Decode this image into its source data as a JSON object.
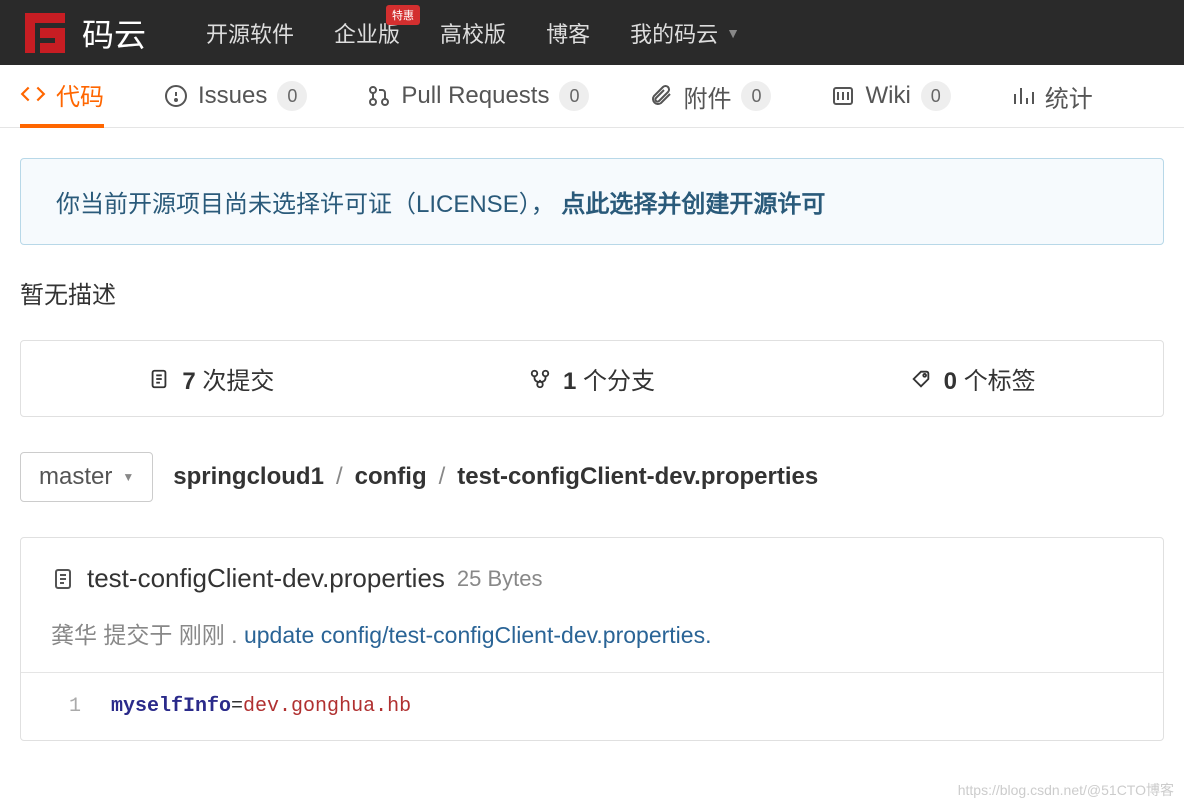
{
  "topNav": {
    "logoText": "码云",
    "items": [
      "开源软件",
      "企业版",
      "高校版",
      "博客"
    ],
    "badge": "特惠",
    "myNav": "我的码云"
  },
  "subNav": {
    "code": "代码",
    "issues": {
      "label": "Issues",
      "count": "0"
    },
    "pr": {
      "label": "Pull Requests",
      "count": "0"
    },
    "attach": {
      "label": "附件",
      "count": "0"
    },
    "wiki": {
      "label": "Wiki",
      "count": "0"
    },
    "stats": "统计"
  },
  "notice": {
    "text": "你当前开源项目尚未选择许可证（LICENSE），",
    "link": "点此选择并创建开源许可"
  },
  "noDesc": "暂无描述",
  "stats": {
    "commits": {
      "count": "7",
      "label": "次提交"
    },
    "branches": {
      "count": "1",
      "label": "个分支"
    },
    "tags": {
      "count": "0",
      "label": "个标签"
    }
  },
  "branch": "master",
  "breadcrumb": [
    "springcloud1",
    "config",
    "test-configClient-dev.properties"
  ],
  "file": {
    "name": "test-configClient-dev.properties",
    "size": "25 Bytes",
    "author": "龚华",
    "submitLabel": "提交于",
    "time": "刚刚",
    "commitMsg": "update config/test-configClient-dev.properties.",
    "lineNum": "1",
    "key": "myselfInfo",
    "eq": "=",
    "val": "dev.gonghua.hb"
  },
  "watermark": "https://blog.csdn.net/@51CTO博客"
}
